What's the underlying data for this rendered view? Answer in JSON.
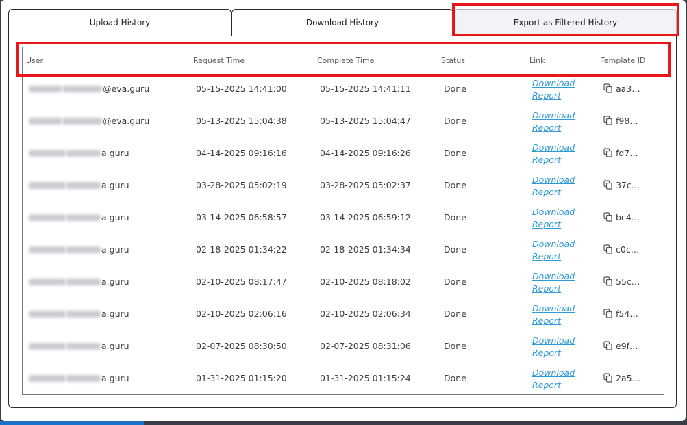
{
  "tabs": [
    {
      "label": "Upload History"
    },
    {
      "label": "Download History"
    },
    {
      "label": "Export as Filtered History"
    }
  ],
  "table": {
    "headers": [
      "User",
      "Request Time",
      "Complete Time",
      "Status",
      "Link",
      "Template ID"
    ],
    "rows": [
      {
        "user": "@eva.guru",
        "request": "05-15-2025 14:41:00",
        "complete": "05-15-2025 14:41:11",
        "status": "Done",
        "link1": "Download",
        "link2": "Report",
        "tid": "aa3…"
      },
      {
        "user": "@eva.guru",
        "request": "05-13-2025 15:04:38",
        "complete": "05-13-2025 15:04:47",
        "status": "Done",
        "link1": "Download",
        "link2": "Report",
        "tid": "f98…"
      },
      {
        "user": "a.guru",
        "request": "04-14-2025 09:16:16",
        "complete": "04-14-2025 09:16:26",
        "status": "Done",
        "link1": "Download",
        "link2": "Report",
        "tid": "fd7…"
      },
      {
        "user": "a.guru",
        "request": "03-28-2025 05:02:19",
        "complete": "03-28-2025 05:02:37",
        "status": "Done",
        "link1": "Download",
        "link2": "Report",
        "tid": "37c…"
      },
      {
        "user": "a.guru",
        "request": "03-14-2025 06:58:57",
        "complete": "03-14-2025 06:59:12",
        "status": "Done",
        "link1": "Download",
        "link2": "Report",
        "tid": "bc4…"
      },
      {
        "user": "a.guru",
        "request": "02-18-2025 01:34:22",
        "complete": "02-18-2025 01:34:34",
        "status": "Done",
        "link1": "Download",
        "link2": "Report",
        "tid": "c0c…"
      },
      {
        "user": "a.guru",
        "request": "02-10-2025 08:17:47",
        "complete": "02-10-2025 08:18:02",
        "status": "Done",
        "link1": "Download",
        "link2": "Report",
        "tid": "55c…"
      },
      {
        "user": "a.guru",
        "request": "02-10-2025 02:06:16",
        "complete": "02-10-2025 02:06:34",
        "status": "Done",
        "link1": "Download",
        "link2": "Report",
        "tid": "f54…"
      },
      {
        "user": "a.guru",
        "request": "02-07-2025 08:30:50",
        "complete": "02-07-2025 08:31:06",
        "status": "Done",
        "link1": "Download",
        "link2": "Report",
        "tid": "e9f…"
      },
      {
        "user": "a.guru",
        "request": "01-31-2025 01:15:20",
        "complete": "01-31-2025 01:15:24",
        "status": "Done",
        "link1": "Download",
        "link2": "Report",
        "tid": "2a5…"
      }
    ]
  },
  "icons": {
    "copy": "copy-icon"
  },
  "colors": {
    "highlight": "#e8151b",
    "link": "#2f9bd6",
    "selected_tab": "#f2f3f7"
  }
}
